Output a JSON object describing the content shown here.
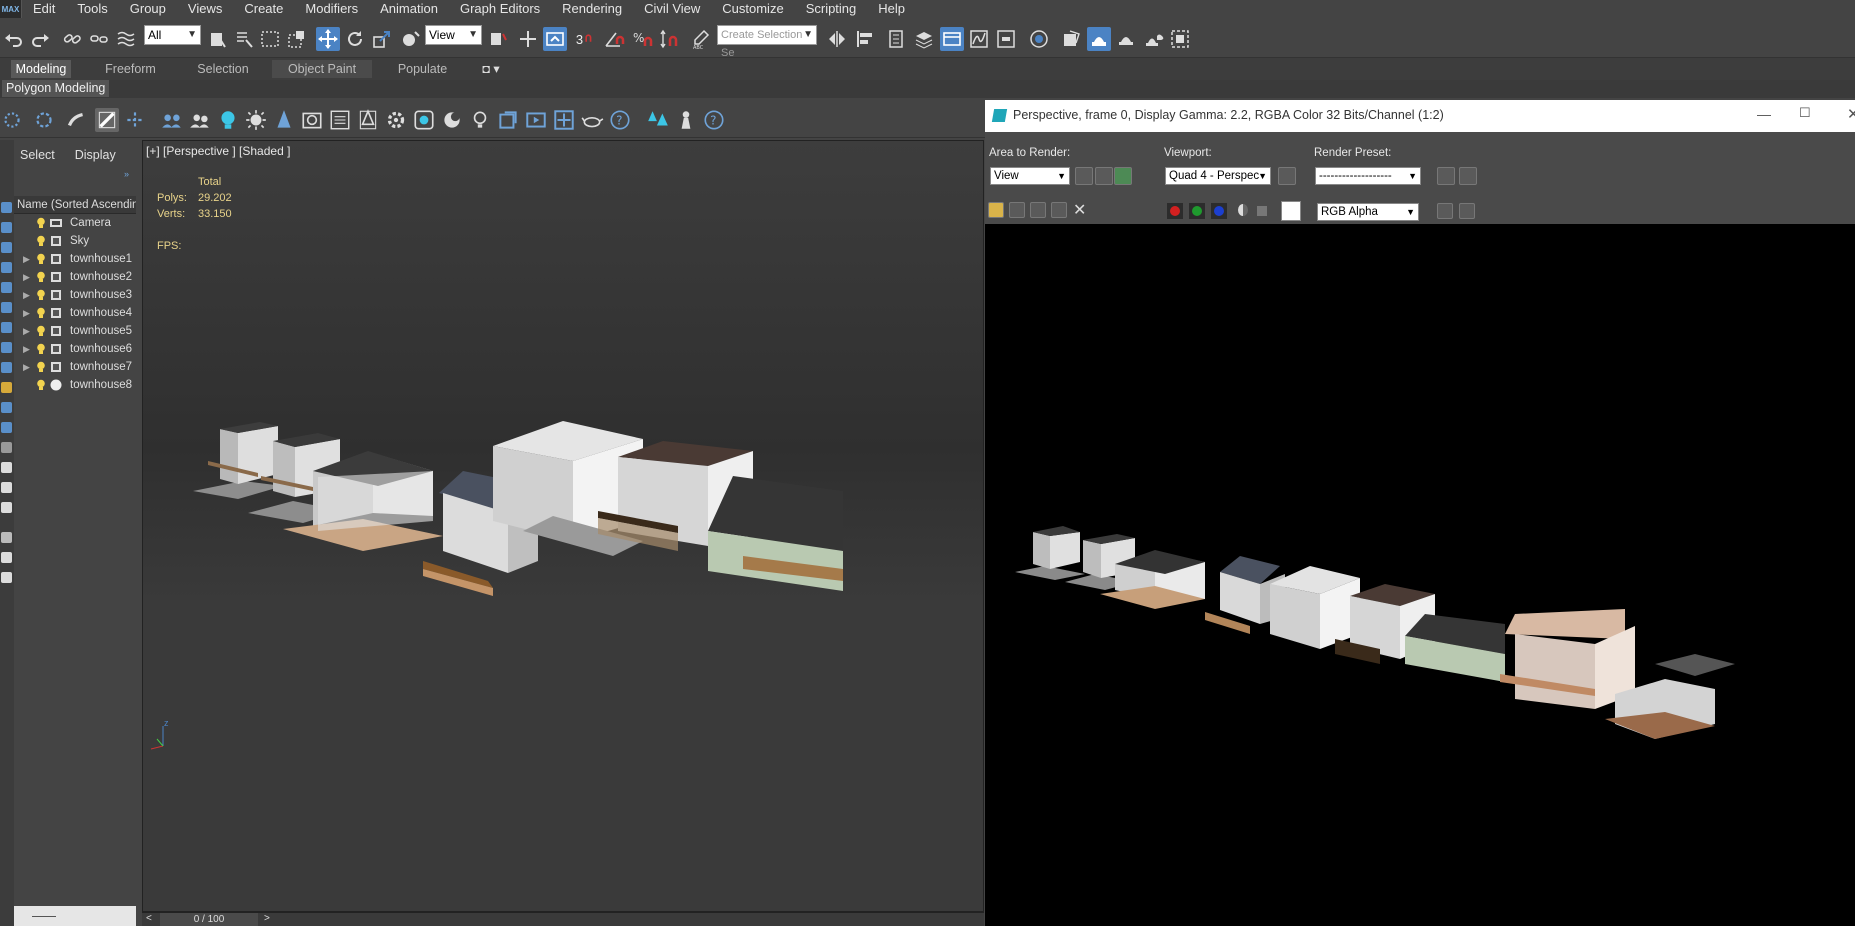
{
  "menu": {
    "logo": "MAX",
    "items": [
      "Edit",
      "Tools",
      "Group",
      "Views",
      "Create",
      "Modifiers",
      "Animation",
      "Graph Editors",
      "Rendering",
      "Civil View",
      "Customize",
      "Scripting",
      "Help"
    ]
  },
  "toolbar": {
    "filter_value": "All",
    "refcoord_value": "View",
    "selection_set_placeholder": "Create Selection Se",
    "snap_label": "3"
  },
  "ribbon": {
    "tabs": [
      "Modeling",
      "Freeform",
      "Selection",
      "Object Paint",
      "Populate"
    ],
    "active_tab": "Modeling",
    "panel_label": "Polygon Modeling"
  },
  "scene_explorer": {
    "tabs": [
      "Select",
      "Display"
    ],
    "column_header": "Name (Sorted Ascending)",
    "items": [
      {
        "name": "Camera",
        "expandable": false,
        "type": "camera"
      },
      {
        "name": "Sky",
        "expandable": false,
        "type": "light"
      },
      {
        "name": "townhouse1",
        "expandable": true,
        "type": "geometry"
      },
      {
        "name": "townhouse2",
        "expandable": true,
        "type": "geometry"
      },
      {
        "name": "townhouse3",
        "expandable": true,
        "type": "geometry"
      },
      {
        "name": "townhouse4",
        "expandable": true,
        "type": "geometry"
      },
      {
        "name": "townhouse5",
        "expandable": true,
        "type": "geometry"
      },
      {
        "name": "townhouse6",
        "expandable": true,
        "type": "geometry"
      },
      {
        "name": "townhouse7",
        "expandable": true,
        "type": "geometry"
      },
      {
        "name": "townhouse8",
        "expandable": false,
        "type": "sphere"
      }
    ]
  },
  "viewport": {
    "label": "[+] [Perspective ] [Shaded ]",
    "stats_header": "Total",
    "polys_label": "Polys:",
    "polys_value": "29.202",
    "verts_label": "Verts:",
    "verts_value": "33.150",
    "fps_label": "FPS:",
    "axis_z": "z"
  },
  "timeline": {
    "prev": "<",
    "frame": "0 / 100",
    "next": ">"
  },
  "render_window": {
    "title": "Perspective, frame 0, Display Gamma: 2.2, RGBA Color 32 Bits/Channel (1:2)",
    "area_label": "Area to Render:",
    "area_value": "View",
    "viewport_label": "Viewport:",
    "viewport_value": "Quad 4 - Perspec",
    "preset_label": "Render Preset:",
    "preset_value": "-------------------",
    "channel_value": "RGB Alpha",
    "channel_colors": [
      "#d32020",
      "#1f9a2e",
      "#1c3fcf"
    ]
  },
  "colors": {
    "accent": "#4b83c4",
    "viewport_bg": "#383838",
    "stats_text": "#e8d38a"
  }
}
